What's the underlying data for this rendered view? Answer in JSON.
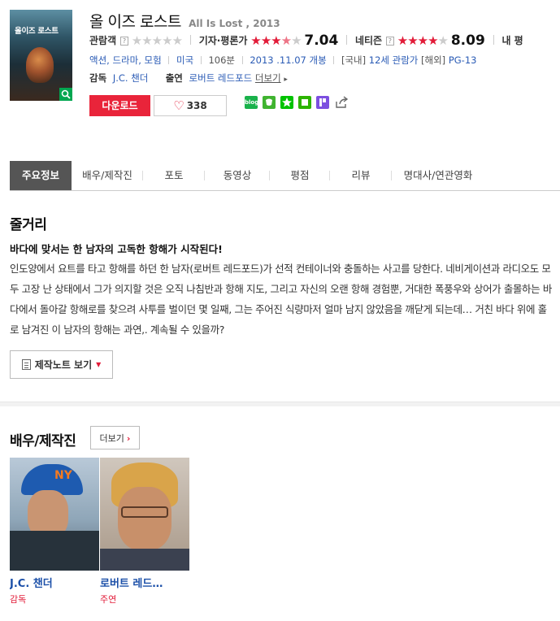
{
  "movie": {
    "title": "올 이즈 로스트",
    "subtitle": "All Is Lost , 2013",
    "poster_text": "올이즈 로스트"
  },
  "ratings": {
    "audience_label": "관람객",
    "audience_help": "?",
    "critic_label": "기자·평론가",
    "critic_score": "7.04",
    "critic_stars": 3.5,
    "netizen_label": "네티즌",
    "netizen_help": "?",
    "netizen_score": "8.09",
    "netizen_stars": 4.0,
    "my_label": "내 평"
  },
  "info": {
    "genre": "액션, 드라마, 모험",
    "country": "미국",
    "runtime": "106분",
    "release": "2013 .11.07 개봉",
    "rating_kr_label": "[국내]",
    "rating_kr": "12세 관람가",
    "rating_intl_label": "[해외]",
    "rating_intl": "PG-13"
  },
  "staff": {
    "director_label": "감독",
    "director": "J.C. 챈더",
    "cast_label": "출연",
    "cast": "로버트 레드포드",
    "more": "더보기"
  },
  "actions": {
    "download": "다운로드",
    "like_count": "338"
  },
  "share": [
    "blog",
    "band",
    "line",
    "gr",
    "p"
  ],
  "tabs": [
    "주요정보",
    "배우/제작진",
    "포토",
    "동영상",
    "평점",
    "리뷰",
    "명대사/연관영화"
  ],
  "synopsis": {
    "section_title": "줄거리",
    "headline": "바다에 맞서는 한 남자의 고독한 항해가 시작된다!",
    "body": "인도양에서 요트를 타고 항해를 하던 한 남자(로버트 레드포드)가 선적 컨테이너와 충돌하는 사고를 당한다. 네비게이션과 라디오도 모두 고장 난 상태에서 그가 의지할 것은 오직 나침반과 항해 지도, 그리고 자신의 오랜 항해 경험뿐, 거대한 폭풍우와 상어가 출몰하는 바다에서 돌아갈 항해로를 찾으려 사투를 벌이던 몇 일째, 그는 주어진 식량마저 얼마 남지 않았음을 깨닫게 되는데… 거친 바다 위에 홀로 남겨진 이 남자의 항해는 과연,. 계속될 수 있을까?",
    "note_button": "제작노트 보기"
  },
  "cast_section": {
    "title": "배우/제작진",
    "more": "더보기",
    "people": [
      {
        "name": "J.C. 챈더",
        "role": "감독"
      },
      {
        "name": "로버트 레드…",
        "role": "주연"
      }
    ]
  },
  "colors": {
    "accent_red": "#e9243a",
    "link_blue": "#2a5bb5",
    "tab_active": "#555555"
  }
}
